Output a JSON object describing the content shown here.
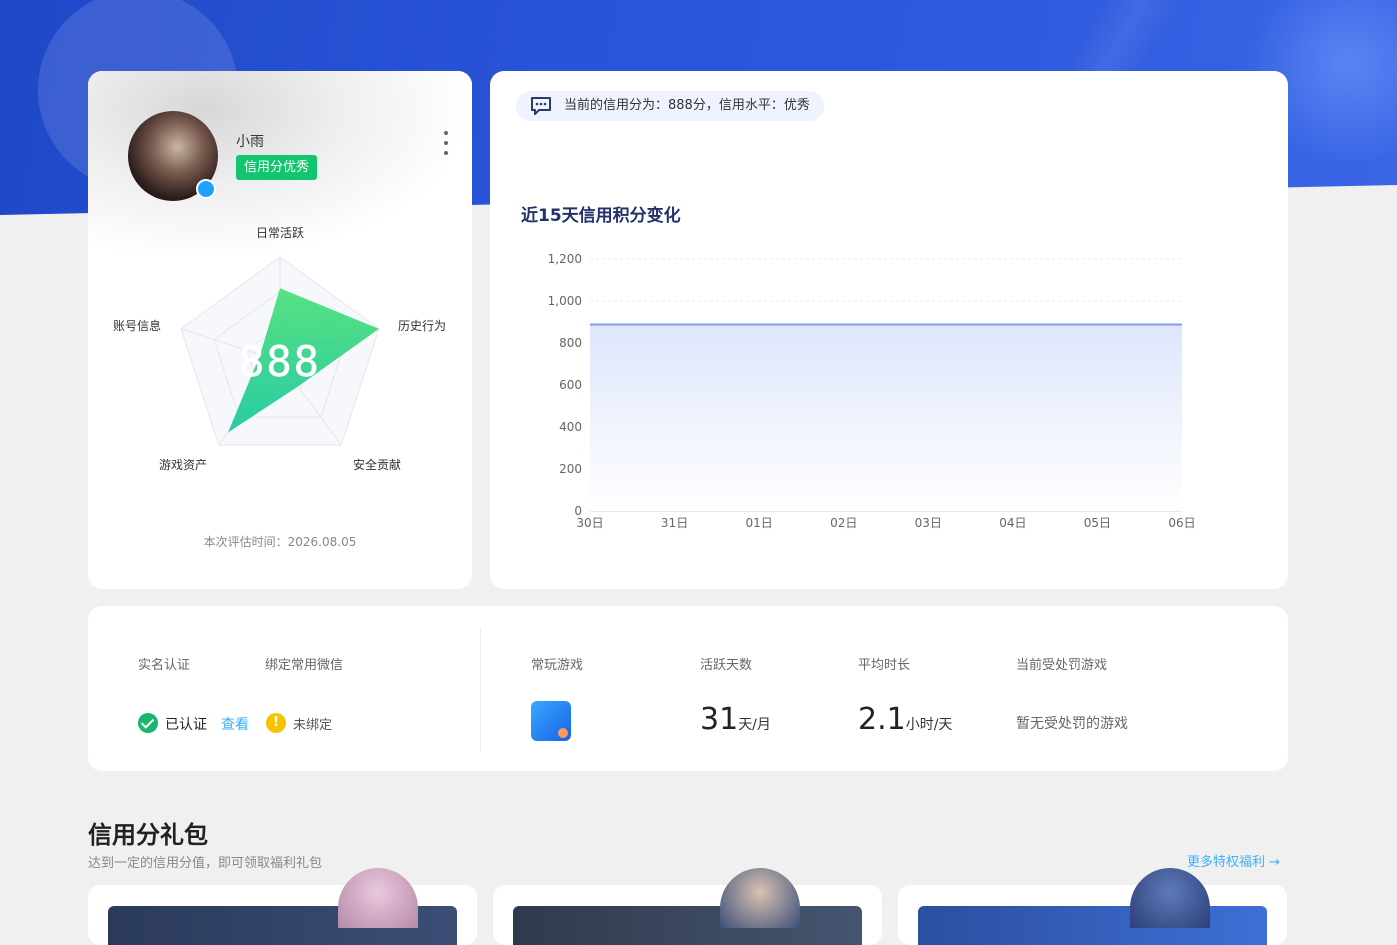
{
  "profile": {
    "username": "小雨",
    "badge": "信用分优秀",
    "score": "888",
    "radar_labels": {
      "daily": "日常活跃",
      "history": "历史行为",
      "security": "安全贡献",
      "assets": "游戏资产",
      "account": "账号信息"
    },
    "eval_time": "本次评估时间：2026.08.05"
  },
  "notice": {
    "text": "当前的信用分为：888分，信用水平：优秀"
  },
  "chart_title": "近15天信用积分变化",
  "chart_data": {
    "type": "area",
    "x": [
      "30日",
      "31日",
      "01日",
      "02日",
      "03日",
      "04日",
      "05日",
      "06日"
    ],
    "series": [
      {
        "values": [
          888,
          888,
          888,
          888,
          888,
          888,
          888,
          888
        ]
      }
    ],
    "ylim": [
      0,
      1200
    ],
    "yticks": [
      "0",
      "200",
      "400",
      "600",
      "800",
      "1,000",
      "1,200"
    ],
    "grid": true
  },
  "radar_data": {
    "type": "radar",
    "axes": [
      "日常活跃",
      "历史行为",
      "安全贡献",
      "游戏资产",
      "账号信息"
    ],
    "values": [
      0.7,
      1.0,
      0.3,
      0.85,
      0.2
    ]
  },
  "info": {
    "realname_label": "实名认证",
    "wechat_label": "绑定常用微信",
    "realname_value": "已认证",
    "view_link": "查看",
    "wechat_value": "未绑定",
    "games_label": "常玩游戏",
    "days_label": "活跃天数",
    "days_value": "31",
    "days_unit": "天/月",
    "duration_label": "平均时长",
    "duration_value": "2.1",
    "duration_unit": "小时/天",
    "punish_label": "当前受处罚游戏",
    "punish_value": "暂无受处罚的游戏"
  },
  "gift": {
    "title": "信用分礼包",
    "subtitle": "达到一定的信用分值，即可领取福利礼包",
    "more": "更多特权福利 →"
  },
  "colors": {
    "accent_green": "#13c56e",
    "brand_blue": "#2a54d8",
    "link_blue": "#3ab0ff",
    "chart_line": "#7f9ee8"
  }
}
